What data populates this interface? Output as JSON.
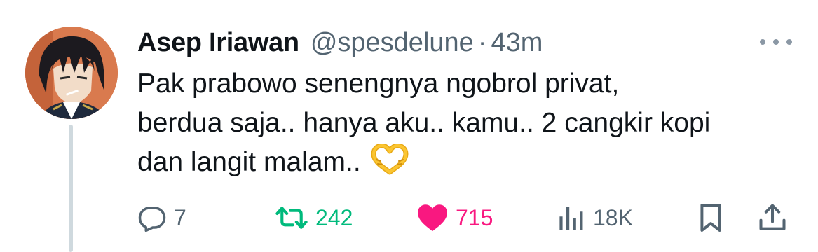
{
  "tweet": {
    "author": {
      "name": "Asep Iriawan",
      "handle": "@spesdelune",
      "avatar": "anime-character-avatar"
    },
    "separator": "·",
    "time": "43m",
    "more_icon": "more-horizontal-icon",
    "text_lines": [
      "Pak prabowo senengnya ngobrol privat,",
      "berdua saja.. hanya aku.. kamu.. 2 cangkir kopi",
      "dan langit malam.."
    ],
    "emoji": "heart-hands-emoji"
  },
  "actions": {
    "reply": {
      "icon": "reply-icon",
      "count": "7"
    },
    "retweet": {
      "icon": "retweet-icon",
      "count": "242",
      "color": "#00ba7c"
    },
    "like": {
      "icon": "heart-filled-icon",
      "count": "715",
      "color": "#f91880"
    },
    "views": {
      "icon": "views-bar-chart-icon",
      "count": "18K"
    },
    "bookmark": {
      "icon": "bookmark-icon"
    },
    "share": {
      "icon": "share-icon"
    }
  },
  "colors": {
    "text_primary": "#0f1419",
    "text_secondary": "#536471",
    "thread_line": "#cfd9de"
  }
}
